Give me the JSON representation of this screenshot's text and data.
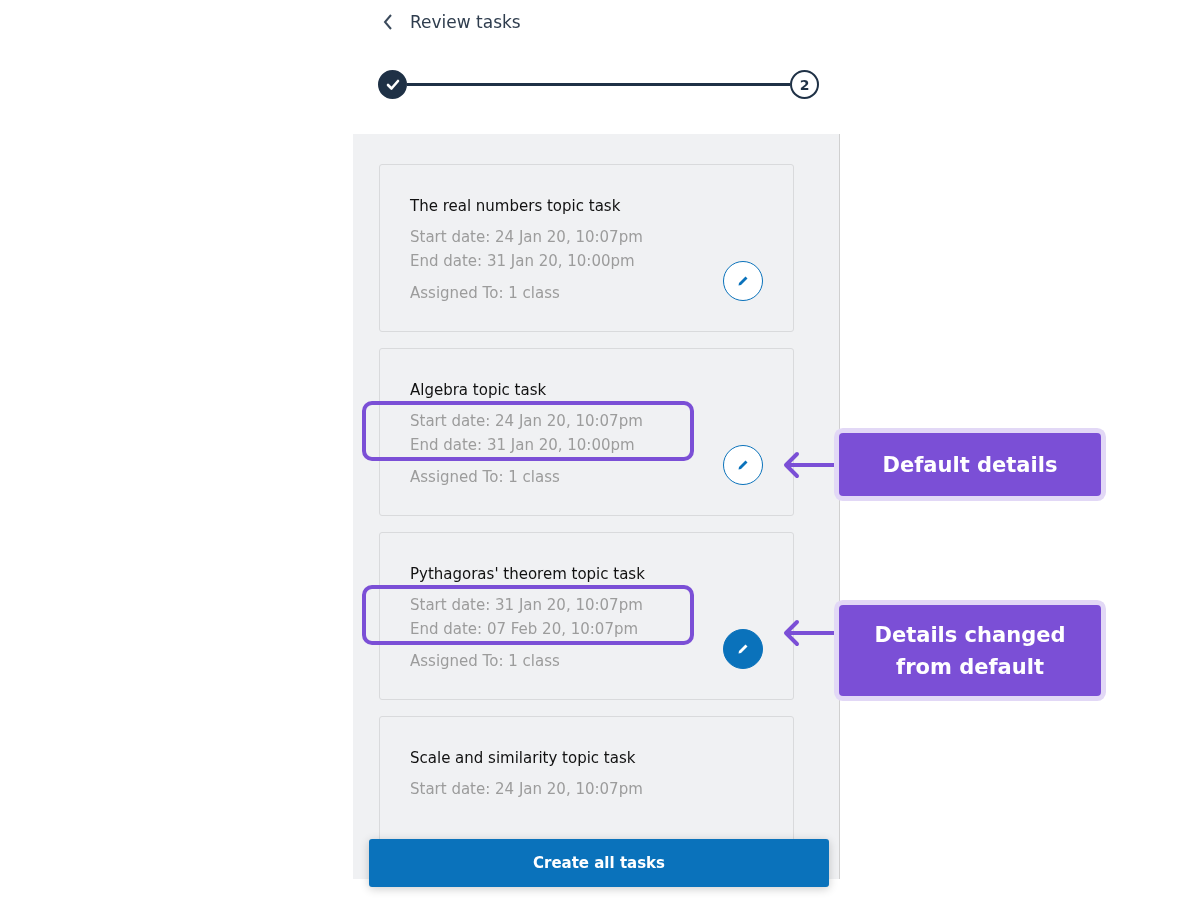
{
  "header": {
    "title": "Review tasks"
  },
  "stepper": {
    "steps": [
      {
        "done": true
      },
      {
        "label": "2",
        "done": false
      }
    ]
  },
  "tasks": [
    {
      "title": "The real numbers topic task",
      "start": "Start date: 24 Jan 20, 10:07pm",
      "end": "End date: 31 Jan 20, 10:00pm",
      "assigned": "Assigned To: 1 class",
      "changed": false
    },
    {
      "title": "Algebra topic task",
      "start": "Start date: 24 Jan 20, 10:07pm",
      "end": "End date: 31 Jan 20, 10:00pm",
      "assigned": "Assigned To: 1 class",
      "changed": false,
      "annotation": "Default details"
    },
    {
      "title": "Pythagoras' theorem topic task",
      "start": "Start date: 31 Jan 20, 10:07pm",
      "end": "End date: 07 Feb 20, 10:07pm",
      "assigned": "Assigned To: 1 class",
      "changed": true,
      "annotation": "Details changed from default"
    },
    {
      "title": "Scale and similarity topic task",
      "start": "Start date: 24 Jan 20, 10:07pm"
    }
  ],
  "primary_button": "Create all tasks"
}
